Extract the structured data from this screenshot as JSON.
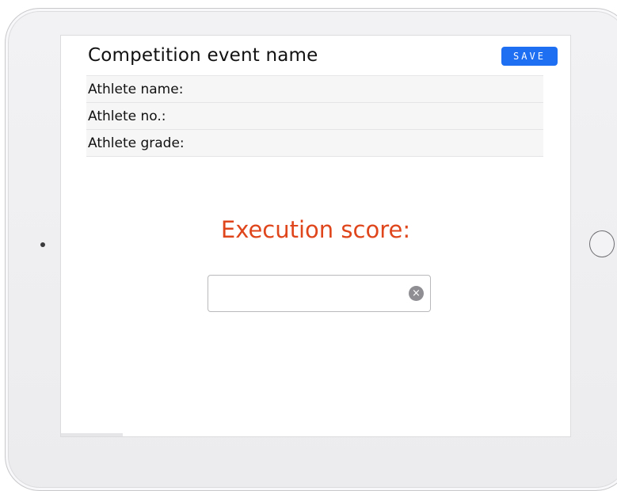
{
  "header": {
    "event_name": "Competition event name",
    "save_label": "SAVE"
  },
  "athlete_info": {
    "rows": [
      {
        "label": "Athlete name:"
      },
      {
        "label": "Athlete no.:"
      },
      {
        "label": "Athlete grade:"
      }
    ]
  },
  "score": {
    "label": "Execution score:",
    "value": "",
    "placeholder": "",
    "clear_icon": "×"
  },
  "colors": {
    "accent_button": "#1e6ff2",
    "score_label": "#e0461c",
    "row_background": "#f6f6f7"
  },
  "icons": {
    "clear": "clear-circle-icon",
    "home": "home-button-icon",
    "camera": "camera-icon"
  }
}
